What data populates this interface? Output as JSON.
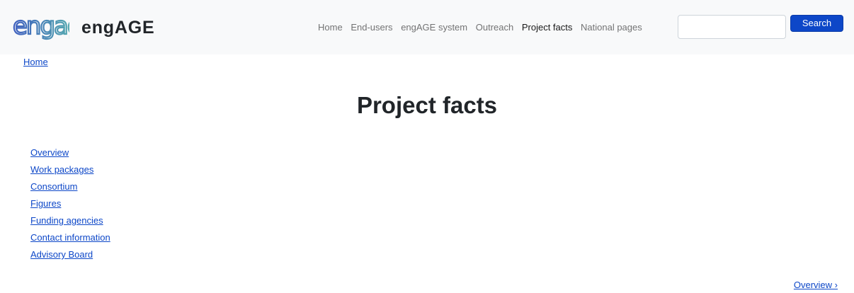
{
  "brand": {
    "logo_text": "engage",
    "name": "engAGE"
  },
  "nav": {
    "items": [
      {
        "label": "Home"
      },
      {
        "label": "End-users"
      },
      {
        "label": "engAGE system"
      },
      {
        "label": "Outreach"
      },
      {
        "label": "Project facts",
        "active": true
      },
      {
        "label": "National pages"
      }
    ],
    "search_value": "",
    "search_button": "Search"
  },
  "breadcrumb": {
    "home": "Home"
  },
  "page": {
    "title": "Project facts"
  },
  "side_nav": {
    "items": [
      {
        "label": "Overview"
      },
      {
        "label": "Work packages"
      },
      {
        "label": "Consortium"
      },
      {
        "label": "Figures"
      },
      {
        "label": "Funding agencies"
      },
      {
        "label": "Contact information"
      },
      {
        "label": "Advisory Board"
      }
    ]
  },
  "pager": {
    "next": "Overview ›"
  },
  "colors": {
    "link": "#0d47c8",
    "button": "#0d47c8",
    "navbar_bg": "#f8f9fa",
    "logo_gradient_start": "#3f5fbf",
    "logo_gradient_end": "#5cc8a8"
  }
}
